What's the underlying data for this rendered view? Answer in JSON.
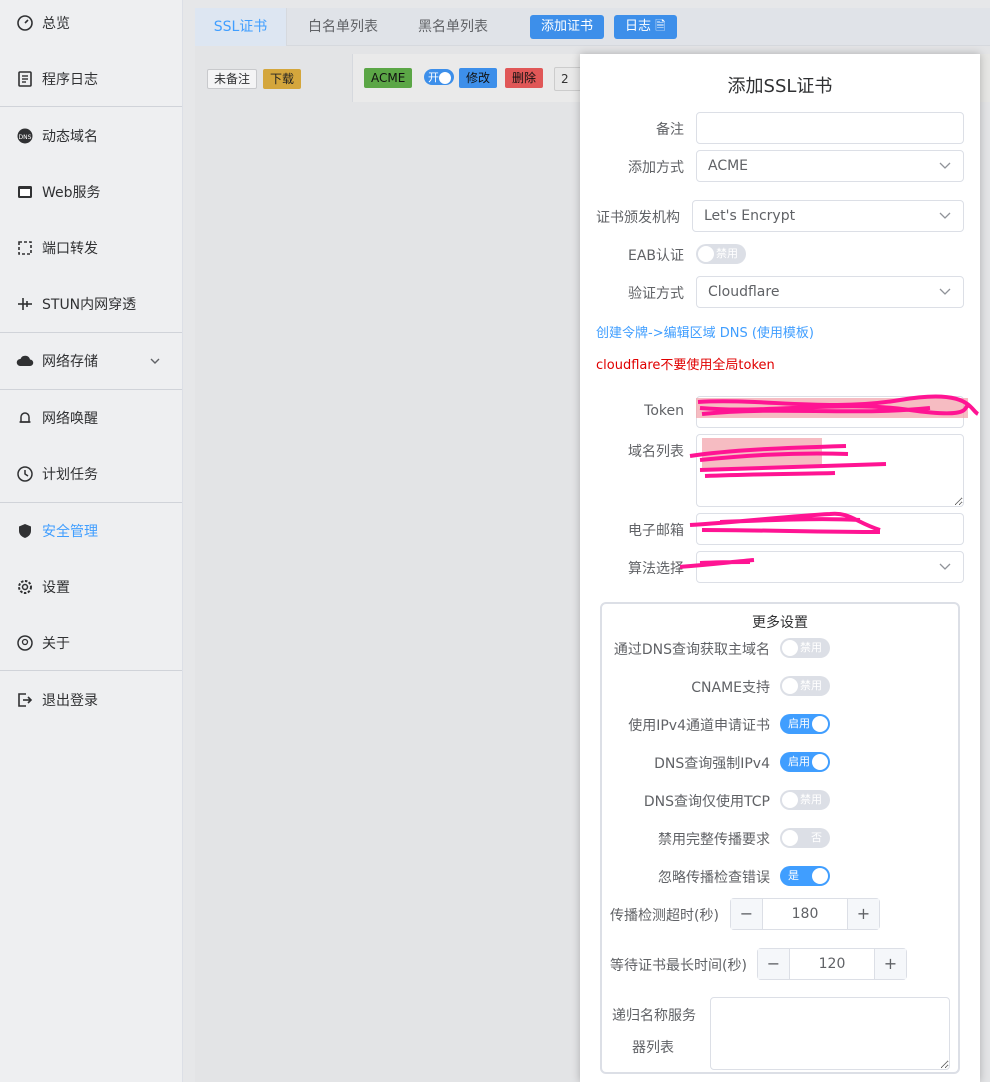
{
  "sidebar": {
    "items": [
      {
        "label": "总览",
        "icon": "dashboard-icon"
      },
      {
        "label": "程序日志",
        "icon": "log-icon"
      },
      {
        "label": "动态域名",
        "icon": "dns-icon"
      },
      {
        "label": "Web服务",
        "icon": "web-icon"
      },
      {
        "label": "端口转发",
        "icon": "port-forward-icon"
      },
      {
        "label": "STUN内网穿透",
        "icon": "stun-icon"
      },
      {
        "label": "网络存储",
        "icon": "cloud-storage-icon"
      },
      {
        "label": "网络唤醒",
        "icon": "bell-icon"
      },
      {
        "label": "计划任务",
        "icon": "clock-icon"
      },
      {
        "label": "安全管理",
        "icon": "shield-icon"
      },
      {
        "label": "设置",
        "icon": "gear-icon"
      },
      {
        "label": "关于",
        "icon": "about-icon"
      },
      {
        "label": "退出登录",
        "icon": "logout-icon"
      }
    ],
    "active": "安全管理"
  },
  "tabs": {
    "ssl": "SSL证书",
    "whitelist": "白名单列表",
    "blacklist": "黑名单列表",
    "add_cert": "添加证书",
    "log": "日志"
  },
  "card": {
    "remark_tag": "未备注",
    "download_tag": "下载",
    "acme_tag": "ACME",
    "switch_text": "开",
    "edit": "修改",
    "delete": "删除",
    "partial": "2"
  },
  "modal": {
    "title": "添加SSL证书",
    "remark_label": "备注",
    "remark_value": "",
    "add_method_label": "添加方式",
    "add_method_value": "ACME",
    "ca_label": "证书颁发机构",
    "ca_value": "Let's Encrypt",
    "eab_label": "EAB认证",
    "eab_state": "禁用",
    "verify_label": "验证方式",
    "verify_value": "Cloudflare",
    "token_link": "创建令牌->编辑区域 DNS (使用模板)",
    "warning": "cloudflare不要使用全局token",
    "token_label": "Token",
    "domains_label": "域名列表",
    "email_label": "电子邮箱",
    "algo_label": "算法选择"
  },
  "more": {
    "title": "更多设置",
    "switches": [
      {
        "label": "通过DNS查询获取主域名",
        "state": "禁用",
        "on": false
      },
      {
        "label": "CNAME支持",
        "state": "禁用",
        "on": false
      },
      {
        "label": "使用IPv4通道申请证书",
        "state": "启用",
        "on": true
      },
      {
        "label": "DNS查询强制IPv4",
        "state": "启用",
        "on": true
      },
      {
        "label": "DNS查询仅使用TCP",
        "state": "禁用",
        "on": false
      },
      {
        "label": "禁用完整传播要求",
        "state": "否",
        "on": false
      },
      {
        "label": "忽略传播检查错误",
        "state": "是",
        "on": true
      }
    ],
    "propagation_timeout_label": "传播检测超时(秒)",
    "propagation_timeout_value": "180",
    "wait_cert_label": "等待证书最长时间(秒)",
    "wait_cert_value": "120",
    "recursive_ns_label_1": "递归名称服务",
    "recursive_ns_label_2": "器列表"
  },
  "colors": {
    "accent": "#409eff",
    "warning": "#e00000",
    "scribble": "#ff1493"
  }
}
